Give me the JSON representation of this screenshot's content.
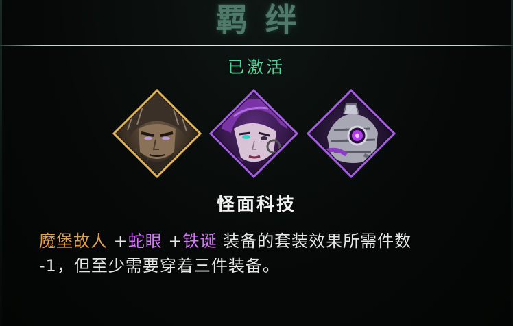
{
  "header": {
    "title": "羁绊"
  },
  "status": {
    "label": "已激活",
    "color": "#52d49a"
  },
  "bond": {
    "name": "怪面科技",
    "members": [
      {
        "name": "魔堡故人",
        "icon": "grizzled-warrior-portrait-icon",
        "frame_color": "#c99a3c"
      },
      {
        "name": "蛇眼",
        "icon": "purple-haired-woman-portrait-icon",
        "frame_color": "#9a4fd6"
      },
      {
        "name": "铁诞",
        "icon": "mechanical-creature-portrait-icon",
        "frame_color": "#9a4fd6"
      }
    ],
    "description": {
      "hero1": "魔堡故人",
      "sep1": " +",
      "hero2": "蛇眼",
      "sep2": " +",
      "hero3": "铁诞",
      "line1_rest": " 装备的套装效果所需件数",
      "line2": "-1，但至少需要穿着三件装备。"
    }
  },
  "colors": {
    "gold_hero": "#e0a04a",
    "purple_hero": "#d277f5",
    "active_green": "#52d49a"
  }
}
